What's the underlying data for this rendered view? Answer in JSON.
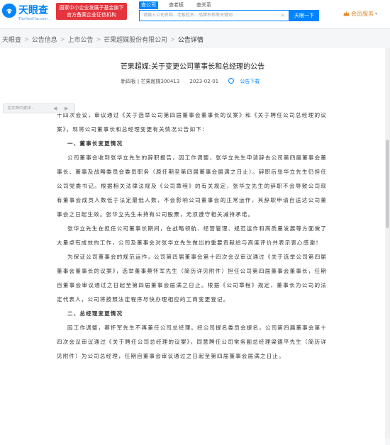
{
  "header": {
    "logo_text": "天眼查",
    "logo_url": "TianYanCha.com",
    "gov_badge_line1": "国家中小企业发展子基金旗下",
    "gov_badge_line2": "官方备案企业征信机构",
    "search_tabs": [
      "查公司",
      "查老板",
      "查关系"
    ],
    "search_tab_active": "查公司",
    "search_placeholder": "请输入公司名称、老板姓名、品牌名称等关键词",
    "search_clear": "×",
    "search_button": "天眼一下",
    "member_label": "会员服务",
    "member_caret": "▾"
  },
  "breadcrumb": {
    "items": [
      "天眼查",
      "公告信息",
      "上市公告",
      "芒果超媒股份有限公司"
    ],
    "current": "公告详情",
    "separator": ">"
  },
  "announcement": {
    "title": "芒果超媒:关于变更公司董事长和总经理的公告",
    "board": "新四板 | 芒果超媒300413",
    "date": "2023-02-01",
    "download_label": "公告下载"
  },
  "float_bar": {
    "placeholder": "在文档中查找...",
    "prev": "◀",
    "next": "▶"
  },
  "document": {
    "p_intro": "十四次会议，审议通过《关于选举公司第四届董事会董事长的议案》和《关于聘任公司总经理的议案》，现将公司董事长和总经理变更有关情况公告如下：",
    "h1": "一、董事长变更情况",
    "p1": "公司董事会收到张华立先生的辞职报告，因工作调整，张华立先生申请辞去公司第四届董事会董事长、董事及战略委员会委员职务（原任期至第四届董事会届满之日止）。辞职后张华立先生仍担任公司党委书记。根据相关法律法规及《公司章程》的有关规定，张华立先生的辞职不会导致公司现有董事会成员人数低于法定最低人数，不会影响公司董事会的正常运作，其辞职申请自送达公司董事会之日起生效。张华立先生未持有公司股票，无须遵守相关减持承诺。",
    "p2": "张华立先生在担任公司董事长期间，在战略领航、经营管理、规范运作和高质量发展等方面做了大量卓有成效的工作，公司及董事会对张华立先生做出的重要贡献给与高度评价并表示衷心感谢！",
    "p3": "为保证公司董事会的规范运作，公司第四届董事会第十四次会议审议通过《关于选举公司第四届董事会董事长的议案》，选举董事蔡怀军先生（简历详见附件）担任公司第四届董事会董事长，任期自董事会审议通过之日起至第四届董事会届满之日止。根据《公司章程》规定，董事长为公司的法定代表人，公司将按照法定程序尽快办理相应的工商变更登记。",
    "h2": "二、总经理变更情况",
    "p4": "因工作调整，蔡怀军先生不再兼任公司总经理。经公司提名委员会提名，公司第四届董事会第十四次会议审议通过《关于聘任公司总经理的议案》，同意聘任公司常务副总经理梁德平先生（简历详见附件）为公司总经理，任期自董事会审议通过之日起至第四届董事会届满之日止。"
  },
  "colors": {
    "brand": "#0084ff",
    "badge": "#e4343d",
    "member": "#e0892b"
  }
}
